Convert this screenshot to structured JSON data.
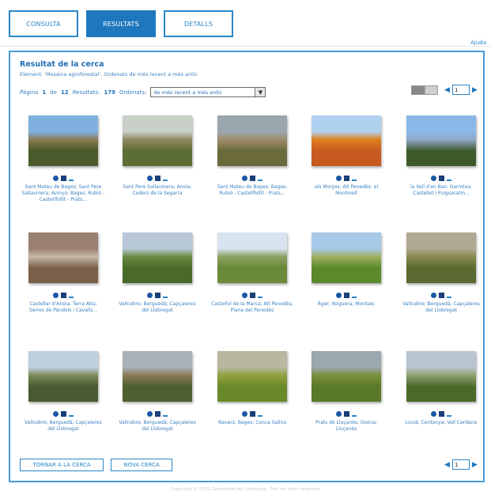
{
  "tabs": [
    {
      "label": "CONSULTA",
      "active": false
    },
    {
      "label": "RESULTATS",
      "active": true
    },
    {
      "label": "DETALLS",
      "active": false
    }
  ],
  "help_link": "Ajuda",
  "results": {
    "title": "Resultat de la cerca",
    "subtitle": "Element: 'Mosaica agroforestal'. Ordenats de més recent a més antic",
    "page_label": "Pàgina",
    "page_current": "1",
    "page_of": "de",
    "page_total": "12",
    "results_label": "Resultats:",
    "results_count": "179",
    "order_label": "Ordenats:",
    "order_value": "de més recent a més antic",
    "page_input_value": "1"
  },
  "colors": {
    "accent": "#1f78bd",
    "border": "#4a9ad6",
    "caption": "#3a7fbf"
  },
  "items": [
    {
      "caption": "Sant Mateu de Bages; Sant Pere Sallavinera; Avinyó; Bages; Rubió - Castellfollit - Prats...",
      "sky": "#7fb0e0",
      "land": "#4a5a2a",
      "accent": "#8a7a50"
    },
    {
      "caption": "Sant Pere Sallavinera; Anoia; Coders de la Segarra",
      "sky": "#c8d0c8",
      "land": "#5d6e35",
      "accent": "#8e8660"
    },
    {
      "caption": "Sant Mateu de Bages; Bages; Rubió - Castellfollit - Prats...",
      "sky": "#9aa6ae",
      "land": "#6a6a3a",
      "accent": "#a08c6a"
    },
    {
      "caption": "els Monjos; Alt Penedès; el Montmell",
      "sky": "#b0d0f0",
      "land": "#c85a20",
      "accent": "#e0801a"
    },
    {
      "caption": "la Vall d'en Bas; Garrotxa; Castellet i Puigsacalm...",
      "sky": "#8ab8e8",
      "land": "#3e5a2a",
      "accent": "#90a8c8"
    },
    {
      "caption": "Castellar d'Anoia; Terra Alta; Serres de Pàndols i Cavalls...",
      "sky": "#9a8070",
      "land": "#7a6048",
      "accent": "#c8b8a8"
    },
    {
      "caption": "Vallcebre; Berguedà; Capçaleres del Llobregat",
      "sky": "#b8c8d8",
      "land": "#4a6a2a",
      "accent": "#6a8a40"
    },
    {
      "caption": "Castellví de la Marca; Alt Penedès; Plana del Penedès",
      "sky": "#d8e4f0",
      "land": "#6a8a3a",
      "accent": "#8aa060"
    },
    {
      "caption": "Àger; Noguera; Montsec",
      "sky": "#a8c8e8",
      "land": "#5a8a2a",
      "accent": "#a0b060"
    },
    {
      "caption": "Vallcebre; Berguedà; Capçaleres del Llobregat",
      "sky": "#b0a890",
      "land": "#5a6a30",
      "accent": "#8a8a50"
    },
    {
      "caption": "Vallcebre; Berguedà; Capçaleres del Llobregat",
      "sky": "#c0d0e0",
      "land": "#4a5a30",
      "accent": "#7a8a58"
    },
    {
      "caption": "Vallcebre; Berguedà; Capçaleres del Llobregat",
      "sky": "#a8b0b8",
      "land": "#4e6030",
      "accent": "#8a7a58"
    },
    {
      "caption": "Navars; Bages; Conca Salina",
      "sky": "#b8b8a0",
      "land": "#6a8a2a",
      "accent": "#90a040"
    },
    {
      "caption": "Prats de Lluçanès; Osona; Lluçanès",
      "sky": "#9aa8b0",
      "land": "#5a7a2a",
      "accent": "#7a9038"
    },
    {
      "caption": "Lovià; Cerdanya; Vall Cerdana",
      "sky": "#b8c4d0",
      "land": "#4a6a2a",
      "accent": "#8ea070"
    }
  ],
  "buttons": {
    "back": "TORNAR A LA CERCA",
    "new": "NOVA CERCA"
  },
  "footer": "Copyright © 2015 Generalitat de Catalunya · Tots els drets reservats"
}
